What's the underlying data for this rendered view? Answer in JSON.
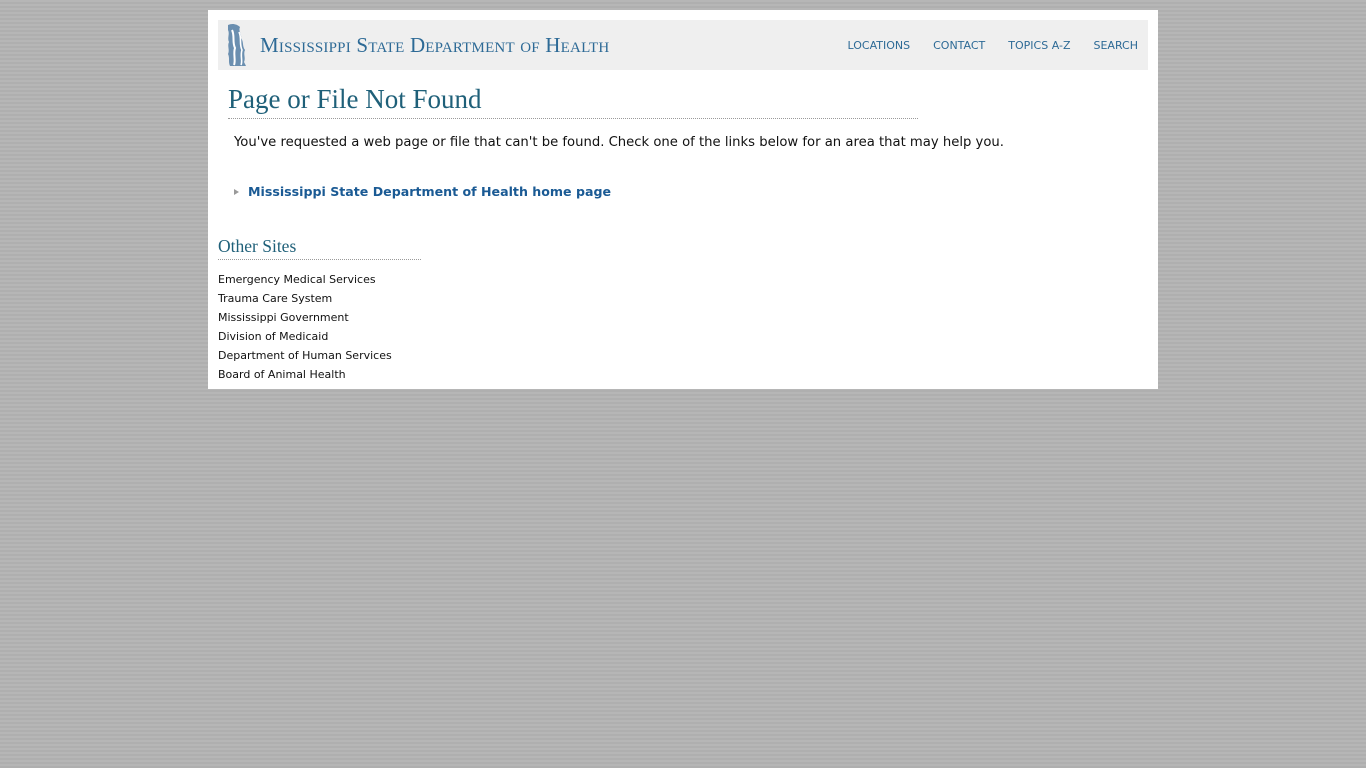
{
  "header": {
    "logo_text": "Mississippi State Department of Health",
    "nav": [
      "LOCATIONS",
      "CONTACT",
      "TOPICS A-Z",
      "SEARCH"
    ]
  },
  "main": {
    "title": "Page or File Not Found",
    "intro": "You've requested a web page or file that can't be found. Check one of the links below for an area that may help you.",
    "home_link": "Mississippi State Department of Health home page"
  },
  "other_sites": {
    "title": "Other Sites",
    "links": [
      "Emergency Medical Services",
      "Trauma Care System",
      "Mississippi Government",
      "Division of Medicaid",
      "Department of Human Services",
      "Board of Animal Health"
    ]
  },
  "colors": {
    "brand_blue": "#2d6a96",
    "heading_teal": "#1f6079",
    "header_bg": "#efefef",
    "page_bg": "#b3b3b3"
  }
}
